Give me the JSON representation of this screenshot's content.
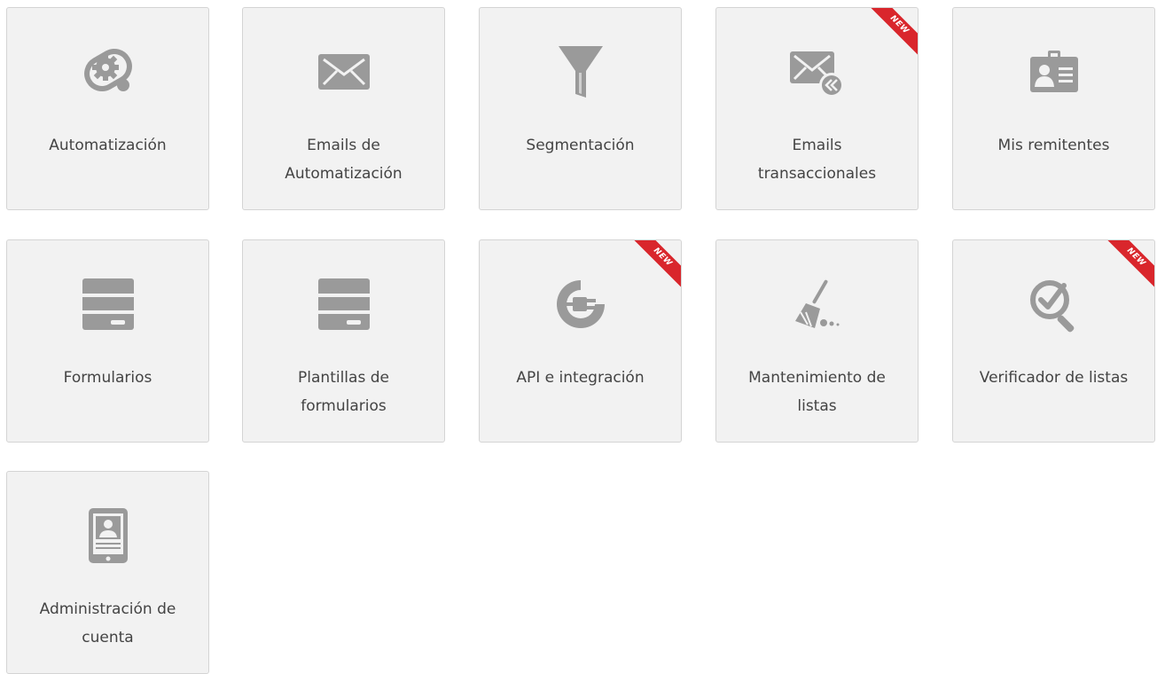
{
  "tiles": [
    {
      "label": "Automatización",
      "icon": "automation-gears-icon",
      "new": false
    },
    {
      "label": "Emails de\nAutomatización",
      "icon": "envelope-icon",
      "new": false
    },
    {
      "label": "Segmentación",
      "icon": "funnel-icon",
      "new": false
    },
    {
      "label": "Emails\ntransaccionales",
      "icon": "envelope-reply-icon",
      "new": true
    },
    {
      "label": "Mis remitentes",
      "icon": "id-card-icon",
      "new": false
    },
    {
      "label": "Formularios",
      "icon": "form-icon",
      "new": false
    },
    {
      "label": "Plantillas de\nformularios",
      "icon": "form-template-icon",
      "new": false
    },
    {
      "label": "API e integración",
      "icon": "plug-icon",
      "new": true
    },
    {
      "label": "Mantenimiento de\nlistas",
      "icon": "broom-icon",
      "new": false
    },
    {
      "label": "Verificador de listas",
      "icon": "magnifier-check-icon",
      "new": true
    },
    {
      "label": "Administración de\ncuenta",
      "icon": "tablet-user-icon",
      "new": false
    }
  ],
  "badge_text": "NEW",
  "colors": {
    "tile_bg": "#f2f2f2",
    "tile_border": "#d4d4d4",
    "icon": "#9a9a9a",
    "label": "#444444",
    "badge": "#d9262c"
  }
}
